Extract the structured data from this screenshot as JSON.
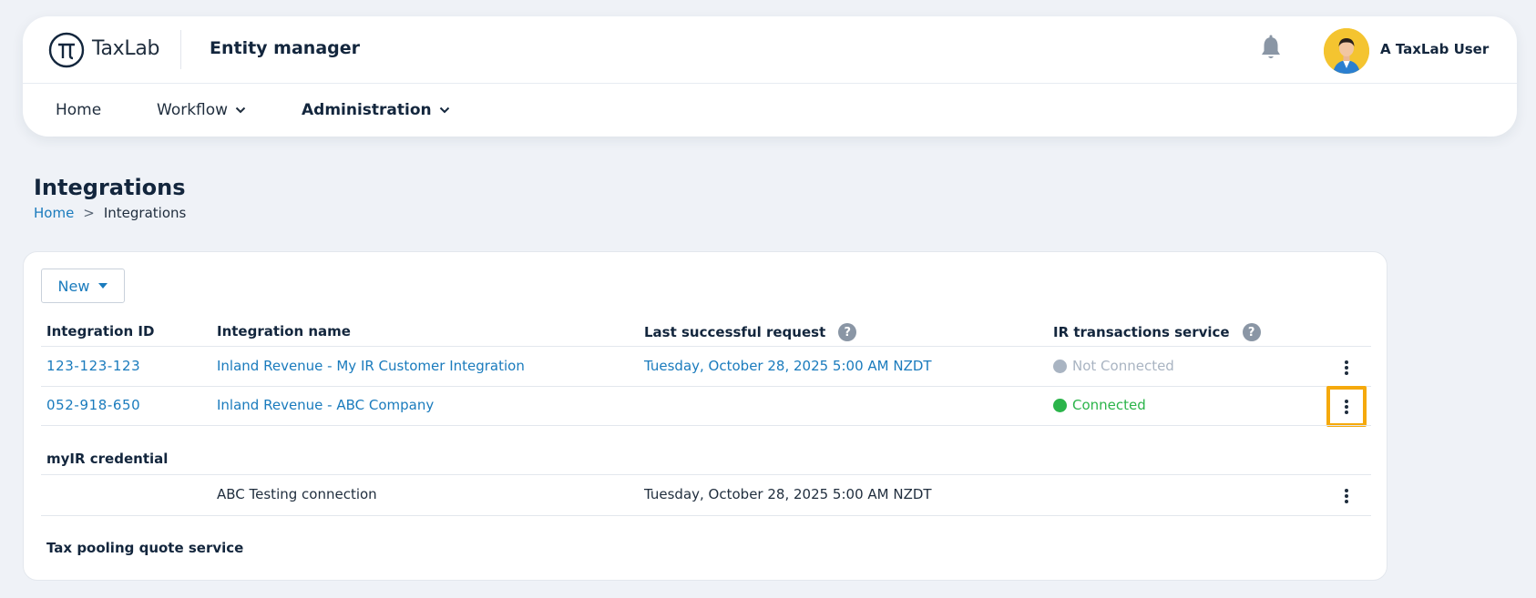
{
  "header": {
    "brand": "TaxLab",
    "app_title": "Entity manager",
    "user_name": "A TaxLab User",
    "nav": [
      {
        "label": "Home"
      },
      {
        "label": "Workflow"
      },
      {
        "label": "Administration"
      }
    ]
  },
  "page": {
    "title": "Integrations",
    "breadcrumb": {
      "home": "Home",
      "separator": ">",
      "current": "Integrations"
    }
  },
  "toolbar": {
    "new_label": "New"
  },
  "table": {
    "columns": [
      "Integration ID",
      "Integration name",
      "Last successful request",
      "IR transactions service"
    ],
    "help_glyph": "?",
    "rows": [
      {
        "id": "123-123-123",
        "name": "Inland Revenue - My IR Customer Integration",
        "last_request": "Tuesday, October 28, 2025 5:00 AM NZDT",
        "status": "Not Connected",
        "status_color": "#a9b4c2"
      },
      {
        "id": "052-918-650",
        "name": "Inland Revenue - ABC Company",
        "last_request": "",
        "status": "Connected",
        "status_color": "#2bb44a"
      }
    ],
    "sections": [
      {
        "label": "myIR credential",
        "rows": [
          {
            "name": "ABC Testing connection",
            "last_request": "Tuesday, October 28, 2025 5:00 AM NZDT"
          }
        ]
      },
      {
        "label": "Tax pooling quote service",
        "rows": []
      }
    ]
  },
  "colors": {
    "link": "#1a7bbd",
    "highlight": "#f5a90c",
    "background": "#eff2f7"
  }
}
